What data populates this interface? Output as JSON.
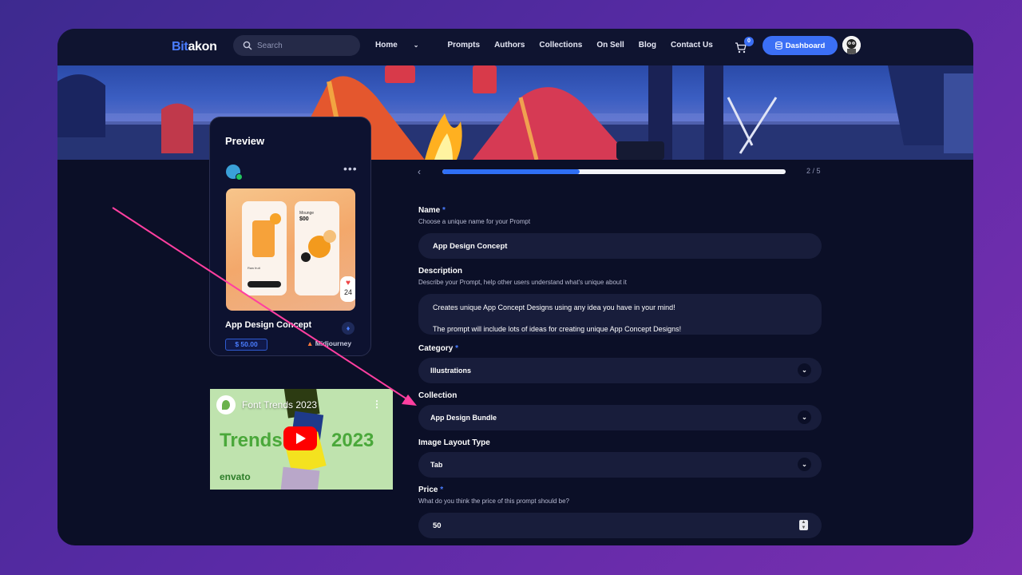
{
  "header": {
    "logo_part1": "Bit",
    "logo_part2": "akon",
    "search_placeholder": "Search",
    "nav": [
      "Home",
      "Prompts",
      "Authors",
      "Collections",
      "On Sell",
      "Blog",
      "Contact Us"
    ],
    "cart_count": "0",
    "dashboard_label": "Dashboard"
  },
  "preview": {
    "title": "Preview",
    "item_name": "App Design Concept",
    "price": "$ 50.00",
    "engine": "Midjourney",
    "likes": "24",
    "mock_balance_label": "Mounge",
    "mock_balance": "$00",
    "mock_caption": "Raw fruit"
  },
  "video": {
    "title": "Font Trends 2023",
    "word_left": "Trends",
    "word_right": "2023",
    "brand": "envato"
  },
  "wizard": {
    "step": "2 / 5",
    "progress": 0.4
  },
  "form": {
    "name_label": "Name",
    "name_required": "*",
    "name_help": "Choose a unique name for your Prompt",
    "name_value": "App Design Concept",
    "description_label": "Description",
    "description_help": "Describe your Prompt, help other users understand what's unique about it",
    "description_line1": "Creates unique App Concept Designs using any idea you have in your mind!",
    "description_line2": "The prompt will include lots of ideas for creating unique App Concept Designs!",
    "category_label": "Category",
    "category_required": "*",
    "category_value": "Illustrations",
    "collection_label": "Collection",
    "collection_value": "App Design Bundle",
    "layout_label": "Image Layout Type",
    "layout_value": "Tab",
    "price_label": "Price",
    "price_required": "*",
    "price_help": "What do you think the price of this prompt should be?",
    "price_value": "50"
  },
  "colors": {
    "accent": "#3b6ff5",
    "frame_bg": "#0b0f27",
    "field_bg": "#181d3b",
    "annotation_arrow": "#ff3fa0"
  },
  "icons": [
    "search-icon",
    "chevron-down-icon",
    "cart-icon",
    "database-icon",
    "more-icon",
    "heart-icon",
    "ethereum-icon",
    "midjourney-icon",
    "play-icon",
    "back-chevron-icon"
  ]
}
